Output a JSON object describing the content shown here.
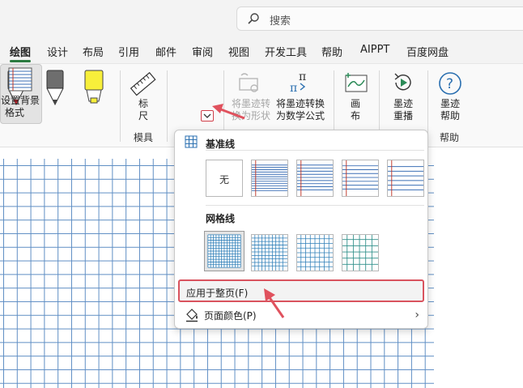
{
  "search": {
    "placeholder": "搜索"
  },
  "tabs": [
    {
      "label": "绘图",
      "active": true
    },
    {
      "label": "设计"
    },
    {
      "label": "布局"
    },
    {
      "label": "引用"
    },
    {
      "label": "邮件"
    },
    {
      "label": "审阅"
    },
    {
      "label": "视图"
    },
    {
      "label": "开发工具"
    },
    {
      "label": "帮助"
    },
    {
      "label": "AIPPT"
    },
    {
      "label": "百度网盘"
    }
  ],
  "ribbon": {
    "ruler": {
      "line1": "标",
      "line2": "尺"
    },
    "bg_format": {
      "line1": "设置背景",
      "line2": "格式"
    },
    "ink_to_shape": {
      "line1": "将墨迹转",
      "line2": "换为形状"
    },
    "ink_to_math": {
      "line1": "将墨迹转换",
      "line2": "为数学公式"
    },
    "canvas": {
      "line1": "画",
      "line2": "布"
    },
    "replay": {
      "line1": "墨迹",
      "line2": "重播"
    },
    "ink_help": {
      "line1": "墨迹",
      "line2": "帮助"
    },
    "group_stencils": "模具",
    "group_help": "帮助"
  },
  "dropdown": {
    "rule_lines_header": "基准线",
    "none_label": "无",
    "grid_header": "网格线",
    "apply_all": "应用于整页(F)",
    "page_color": "页面颜色(P)"
  },
  "colors": {
    "pen_red": "#e0202b",
    "pen_gray": "#6e6e6e",
    "highlighter_yellow": "#f7ef3a",
    "grid_line": "#5f8ec4",
    "accent_green": "#2b7a3f",
    "annotation_red": "#d9535e"
  }
}
